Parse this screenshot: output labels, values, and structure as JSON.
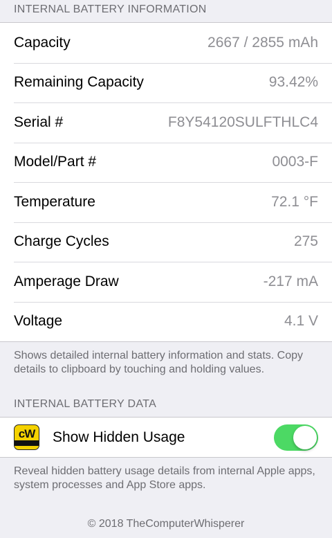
{
  "battery_info": {
    "header": "INTERNAL BATTERY INFORMATION",
    "rows": [
      {
        "label": "Capacity",
        "value": "2667 / 2855 mAh"
      },
      {
        "label": "Remaining Capacity",
        "value": "93.42%"
      },
      {
        "label": "Serial #",
        "value": "F8Y54120SULFTHLC4"
      },
      {
        "label": "Model/Part #",
        "value": "0003-F"
      },
      {
        "label": "Temperature",
        "value": "72.1 °F"
      },
      {
        "label": "Charge Cycles",
        "value": "275"
      },
      {
        "label": "Amperage Draw",
        "value": "-217 mA"
      },
      {
        "label": "Voltage",
        "value": "4.1 V"
      }
    ],
    "footer": "Shows detailed internal battery information and stats. Copy details to clipboard by touching and holding values."
  },
  "battery_data": {
    "header": "INTERNAL BATTERY DATA",
    "toggle": {
      "label": "Show Hidden Usage",
      "on": true,
      "icon": "cw-app-icon",
      "accent": "#4cd964"
    },
    "footer": "Reveal hidden battery usage details from internal Apple apps, system processes and App Store apps."
  },
  "copyright": "© 2018 TheComputerWhisperer"
}
